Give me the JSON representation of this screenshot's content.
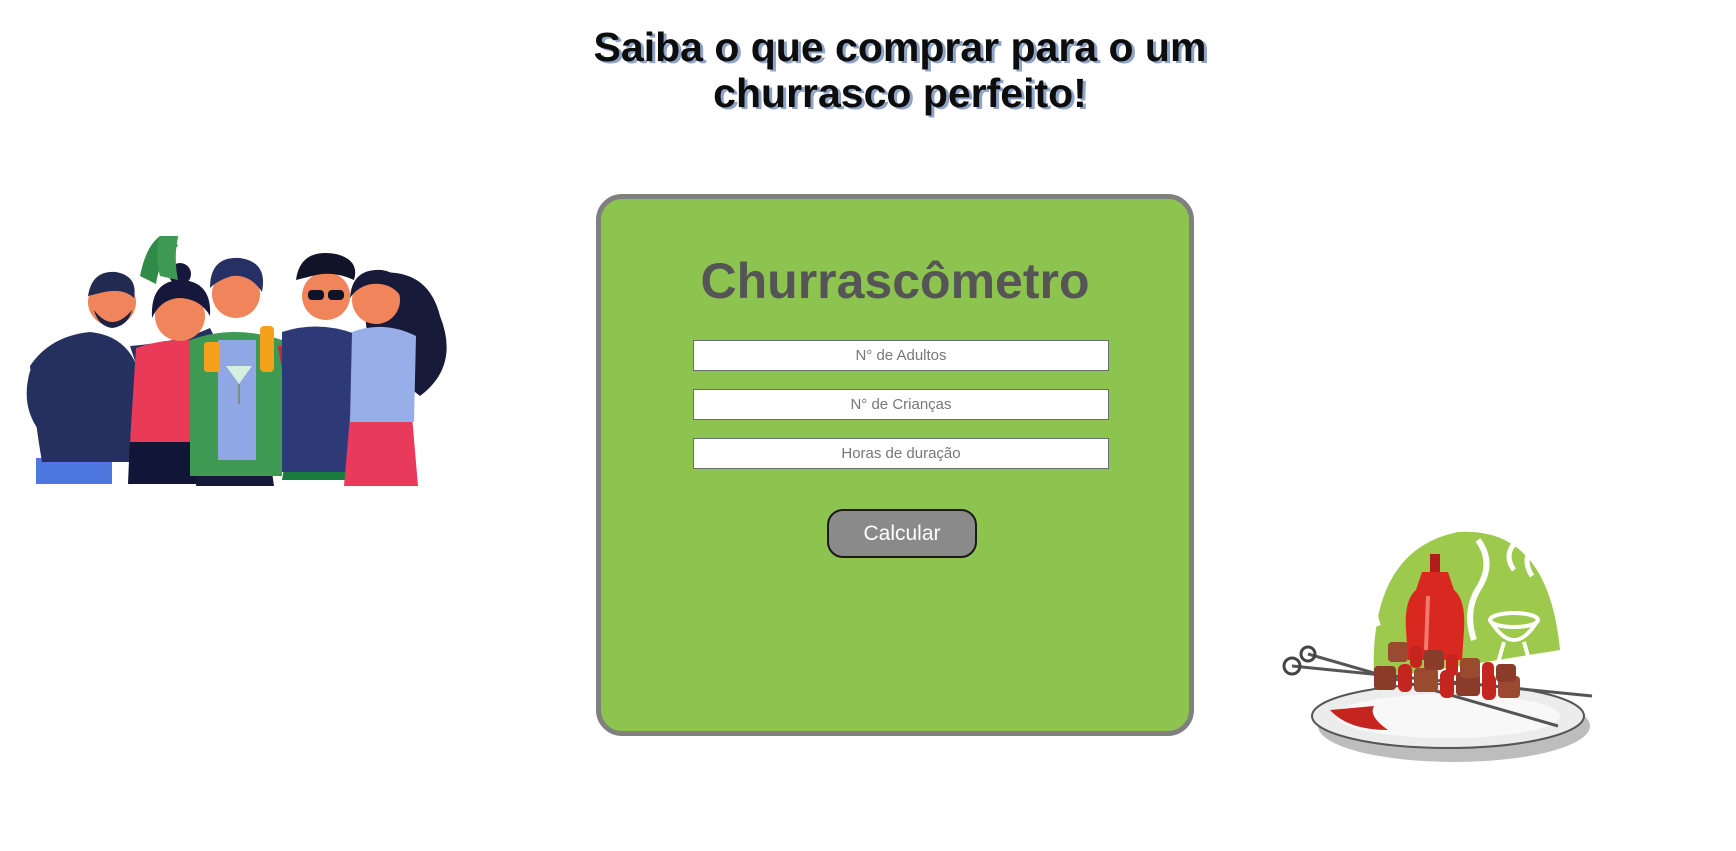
{
  "header": {
    "headline_line1": "Saiba o que comprar para o um",
    "headline_line2": "churrasco perfeito!"
  },
  "calculator": {
    "title": "Churrascômetro",
    "adults_placeholder": "N° de Adultos",
    "children_placeholder": "N° de Crianças",
    "hours_placeholder": "Horas de duração",
    "calculate_label": "Calcular"
  },
  "illustrations": {
    "left": "people-toasting-illustration",
    "right": "barbecue-skewers-illustration"
  },
  "colors": {
    "card_background": "#8dc450",
    "card_border": "#808080",
    "button_background": "#8a8a8a",
    "title_color": "#555555"
  }
}
